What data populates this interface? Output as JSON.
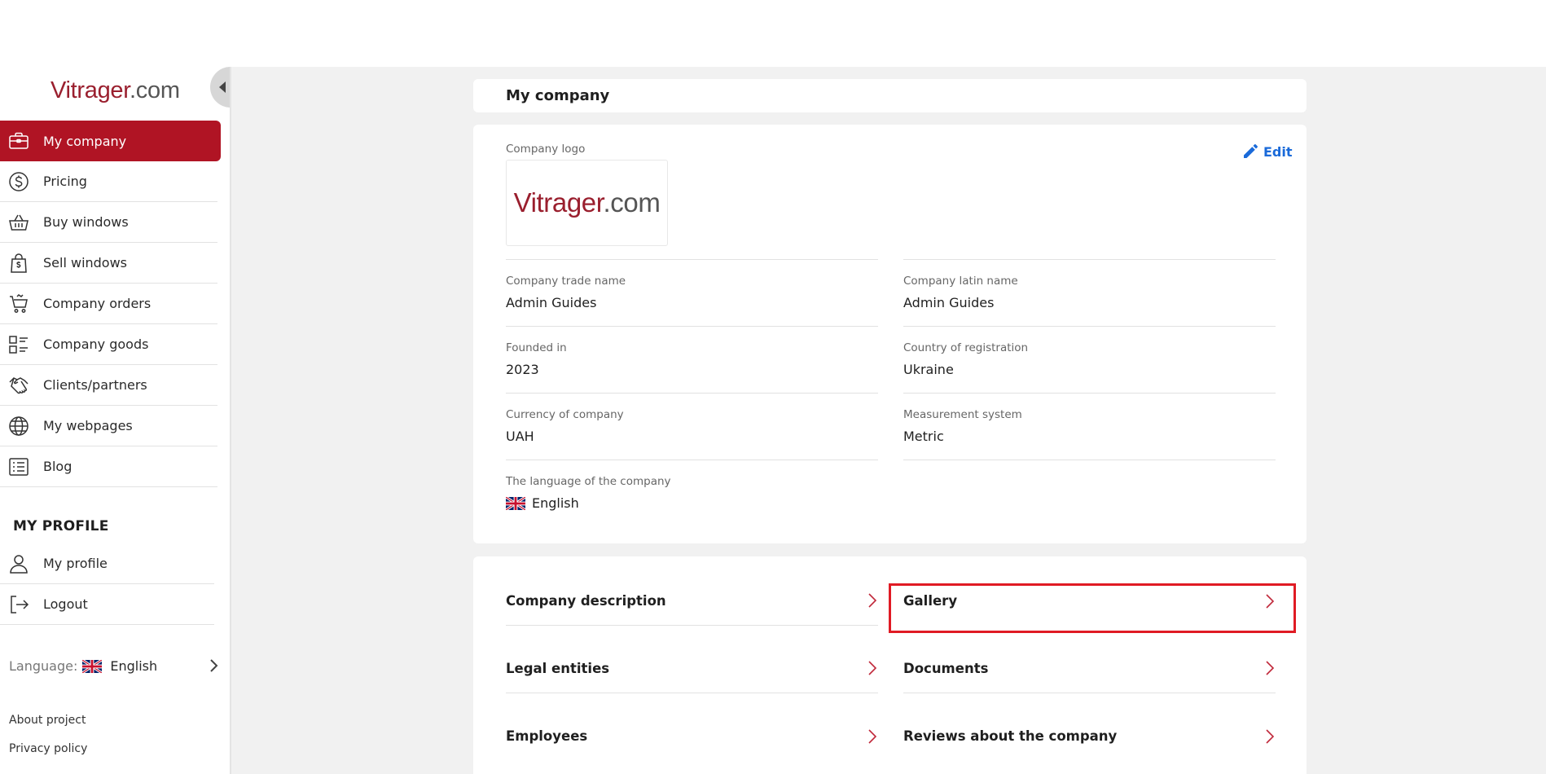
{
  "sidebar": {
    "logo_brand": "Vitrager",
    "logo_tld": ".com",
    "nav": [
      {
        "label": "My company",
        "icon": "briefcase-icon"
      },
      {
        "label": "Pricing",
        "icon": "dollar-circle-icon"
      },
      {
        "label": "Buy windows",
        "icon": "basket-icon"
      },
      {
        "label": "Sell windows",
        "icon": "shopping-bag-icon"
      },
      {
        "label": "Company orders",
        "icon": "cart-icon"
      },
      {
        "label": "Company goods",
        "icon": "list-grid-icon"
      },
      {
        "label": "Clients/partners",
        "icon": "handshake-icon"
      },
      {
        "label": "My webpages",
        "icon": "globe-icon"
      },
      {
        "label": "Blog",
        "icon": "article-icon"
      }
    ],
    "profile_section_title": "MY PROFILE",
    "profile_nav": [
      {
        "label": "My profile",
        "icon": "user-icon"
      },
      {
        "label": "Logout",
        "icon": "logout-icon"
      }
    ],
    "language_label": "Language:",
    "language_value": "English",
    "footer_links": [
      "About project",
      "Privacy policy"
    ]
  },
  "main": {
    "page_title": "My company",
    "edit_label": "Edit",
    "logo_label": "Company logo",
    "logo_brand": "Vitrager",
    "logo_tld": ".com",
    "fields": {
      "trade_name_label": "Company trade name",
      "trade_name_value": "Admin Guides",
      "latin_name_label": "Company latin name",
      "latin_name_value": "Admin Guides",
      "founded_label": "Founded in",
      "founded_value": "2023",
      "country_label": "Country of registration",
      "country_value": "Ukraine",
      "currency_label": "Currency of company",
      "currency_value": "UAH",
      "measurement_label": "Measurement system",
      "measurement_value": "Metric",
      "language_label": "The language of the company",
      "language_value": "English"
    },
    "links": [
      {
        "label": "Company description"
      },
      {
        "label": "Gallery"
      },
      {
        "label": "Legal entities"
      },
      {
        "label": "Documents"
      },
      {
        "label": "Employees"
      },
      {
        "label": "Reviews about the company"
      }
    ]
  },
  "colors": {
    "accent": "#b01424",
    "link_blue": "#1a6ad9",
    "highlight": "#e01b24"
  }
}
